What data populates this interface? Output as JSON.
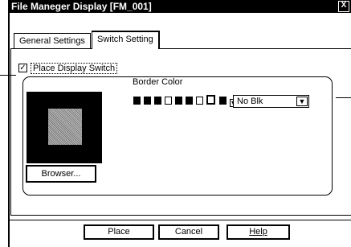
{
  "window": {
    "title": "File Maneger Display [FM_001]",
    "close_glyph": "X"
  },
  "tabs": [
    {
      "label": "General Settings",
      "active": false
    },
    {
      "label": "Switch Setting",
      "active": true
    }
  ],
  "place_switch": {
    "label": "Place Display Switch",
    "checked": true
  },
  "border_color": {
    "label": "Border Color",
    "swatches": [
      "black",
      "black",
      "black",
      "white",
      "black",
      "black",
      "white",
      "black",
      "white",
      "black"
    ],
    "selected_value": "No Blk"
  },
  "preview": {
    "browse_label": "Browser..."
  },
  "footer": {
    "place_label": "Place",
    "cancel_label": "Cancel",
    "help_label": "Help"
  },
  "colors": {
    "frame": "#000000",
    "background": "#ffffff",
    "preview_bg": "#000000",
    "preview_pattern": "#9a9a9a"
  }
}
